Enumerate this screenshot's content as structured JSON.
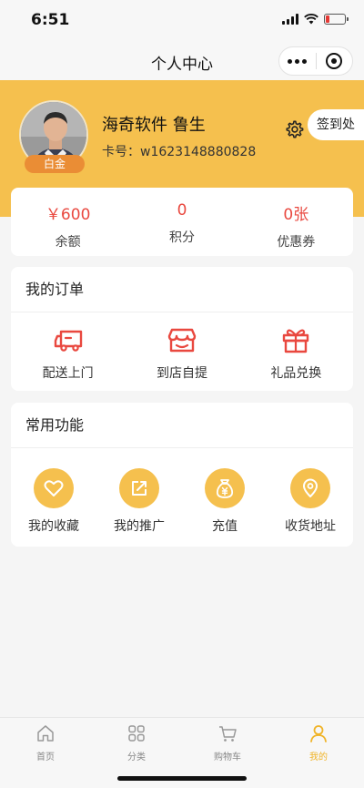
{
  "status_bar": {
    "time": "6:51"
  },
  "nav": {
    "title": "个人中心"
  },
  "profile": {
    "name": "海奇软件 鲁生",
    "card_number": "卡号：w1623148880828",
    "level": "白金",
    "checkin_label": "签到处"
  },
  "stats": [
    {
      "value": "￥600",
      "label": "余额"
    },
    {
      "value": "0",
      "label": "积分"
    },
    {
      "value": "0张",
      "label": "优惠券"
    }
  ],
  "orders": {
    "title": "我的订单",
    "items": [
      {
        "label": "配送上门",
        "icon": "delivery-truck-icon"
      },
      {
        "label": "到店自提",
        "icon": "storefront-icon"
      },
      {
        "label": "礼品兑换",
        "icon": "gift-icon"
      }
    ]
  },
  "functions": {
    "title": "常用功能",
    "items": [
      {
        "label": "我的收藏",
        "icon": "heart-icon"
      },
      {
        "label": "我的推广",
        "icon": "share-icon"
      },
      {
        "label": "充值",
        "icon": "money-bag-icon"
      },
      {
        "label": "收货地址",
        "icon": "location-pin-icon"
      }
    ]
  },
  "tabs": [
    {
      "label": "首页",
      "icon": "home-icon"
    },
    {
      "label": "分类",
      "icon": "grid-icon"
    },
    {
      "label": "购物车",
      "icon": "cart-icon"
    },
    {
      "label": "我的",
      "icon": "user-icon",
      "active": true
    }
  ],
  "colors": {
    "brand_yellow": "#f5c04e",
    "accent_red": "#e9483f",
    "badge_orange": "#ea8d35",
    "tab_active": "#f0b429"
  }
}
